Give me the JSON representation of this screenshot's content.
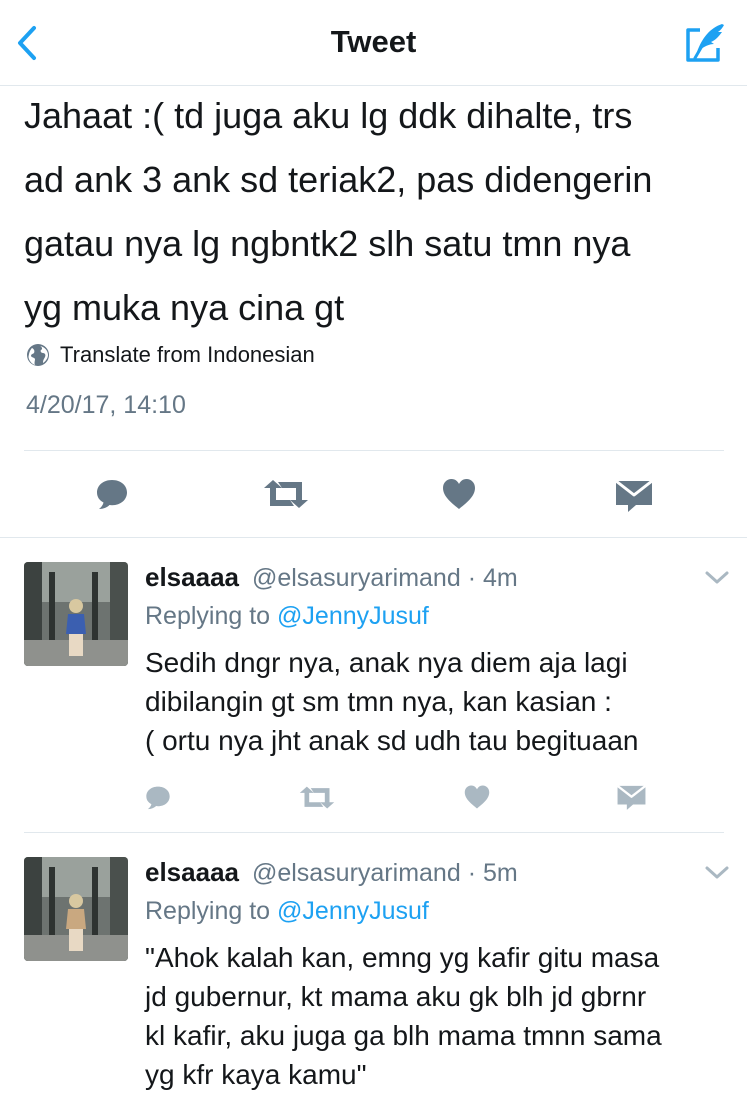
{
  "header": {
    "title": "Tweet",
    "back_icon": "chevron-left-icon",
    "compose_icon": "compose-tweet-icon",
    "accent_color": "#1da1f2"
  },
  "main_tweet": {
    "text_lines": [
      "Jahaat :( td juga aku lg ddk dihalte, trs",
      "ad ank 3 ank sd teriak2, pas didengerin",
      "gatau nya lg ngbntk2 slh satu tmn nya",
      "yg muka nya cina gt"
    ],
    "translate_label": "Translate from Indonesian",
    "timestamp": "4/20/17, 14:10",
    "actions": [
      "reply-icon",
      "retweet-icon",
      "like-icon",
      "direct-message-icon"
    ]
  },
  "replies": [
    {
      "display_name": "elsaaaa",
      "handle": "@elsasuryarimand",
      "separator": "·",
      "age": "4m",
      "replying_prefix": "Replying to",
      "replying_to": "@JennyJusuf",
      "text_lines": [
        "Sedih dngr nya, anak nya diem aja lagi",
        "dibilangin gt sm tmn nya, kan kasian :",
        "( ortu nya jht anak sd udh tau begituaan"
      ]
    },
    {
      "display_name": "elsaaaa",
      "handle": "@elsasuryarimand",
      "separator": "·",
      "age": "5m",
      "replying_prefix": "Replying to",
      "replying_to": "@JennyJusuf",
      "text_lines": [
        "\"Ahok kalah kan, emng yg kafir gitu masa",
        "jd gubernur, kt mama aku gk blh jd gbrnr",
        "kl kafir, aku juga ga blh mama tmnn sama",
        "yg kfr kaya kamu\""
      ]
    }
  ],
  "colors": {
    "text": "#14171a",
    "secondary": "#657786",
    "icon": "#657786",
    "reply_icon": "#aab8c2",
    "divider": "#e1e8ed",
    "link": "#1da1f2"
  }
}
